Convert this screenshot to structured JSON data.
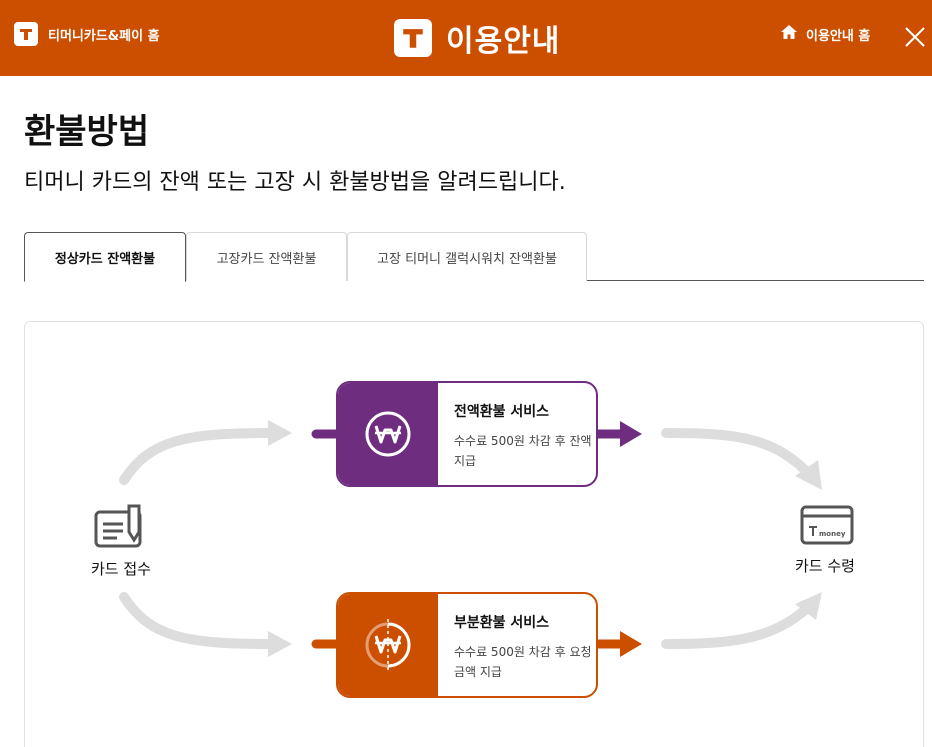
{
  "header": {
    "home_link": "티머니카드&페이 홈",
    "title": "이용안내",
    "guide_home": "이용안내 홈"
  },
  "page": {
    "title": "환불방법",
    "subtitle": "티머니 카드의 잔액 또는 고장 시 환불방법을 알려드립니다."
  },
  "tabs": [
    {
      "label": "정상카드 잔액환불",
      "active": true
    },
    {
      "label": "고장카드 잔액환불",
      "active": false
    },
    {
      "label": "고장 티머니 갤럭시워치 잔액환불",
      "active": false
    }
  ],
  "diagram": {
    "start_label": "카드 접수",
    "end_label": "카드 수령",
    "card_logo_text": "money",
    "full_service": {
      "title": "전액환불 서비스",
      "desc": "수수료 500원 차감 후 잔액 지급",
      "color": "#6f2d7f"
    },
    "partial_service": {
      "title": "부분환불 서비스",
      "desc": "수수료 500원 차감 후 요청 금액 지급",
      "color": "#cc4f00"
    }
  },
  "colors": {
    "brand": "#cc4f00",
    "purple": "#6f2d7f",
    "arrow_gray": "#dddddd"
  }
}
